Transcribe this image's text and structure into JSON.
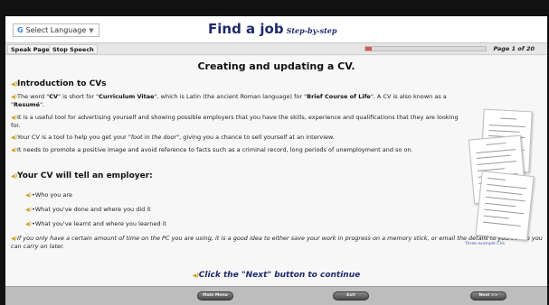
{
  "header": {
    "language_label": "Select Language",
    "language_logo": "G",
    "title": "Find a job",
    "subtitle": "Step-by-step"
  },
  "toolbar": {
    "speak_page": "Speak Page",
    "stop_speech": "Stop Speech",
    "progress_fraction": 0.05,
    "page_indicator": "Page 1 of 20"
  },
  "content": {
    "heading": "Creating and updating a CV.",
    "intro_heading": "Introduction to CVs",
    "p1": {
      "a": "The word \"",
      "b": "CV",
      "c": "\" is short for \"",
      "d": "Curriculum Vitae",
      "e": "\", which is Latin (the ancient Roman language) for \"",
      "f": "Brief Course of Life",
      "g": "\". A CV is also known as a \"",
      "h": "Resumé",
      "i": "\"."
    },
    "p2": "It is a useful tool for advertising yourself and showing possible employers that you have the skills, experience and qualifications that they are looking for.",
    "p3": {
      "a": "Your CV is a tool to help you get your \"",
      "b": "foot in the door",
      "c": "\", giving you a chance to sell yourself at an interview."
    },
    "p4": "It needs to promote a positive image and avoid reference to facts such as a criminal record, long periods of unemployment and so on.",
    "employer_heading": "Your CV will tell an employer:",
    "bullets": [
      "•Who you are",
      "•What you've done and where you did it",
      "•What you've learnt and where you learned it"
    ],
    "note": "If you only have a certain amount of time on the PC you are using, it is a good idea to either save your work in progress on a memory stick, or email the details to yourself so you can carry on later.",
    "cta": "Click the \"Next\" button to continue",
    "image_caption": "Three example CVs"
  },
  "footer": {
    "main_menu": "Main Menu",
    "exit": "Exit",
    "next": "Next >>"
  },
  "colors": {
    "title": "#1f2a6b",
    "speaker_icon": "#c9a227",
    "progress_fill": "#d9534f",
    "footer_bg": "#bdbdbd"
  },
  "icons": [
    "speaker-icon",
    "google-logo-icon",
    "dropdown-caret-icon"
  ]
}
